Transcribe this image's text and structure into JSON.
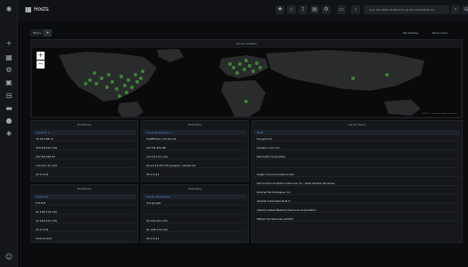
{
  "header": {
    "title": "Hosts"
  },
  "toolbar": {
    "time_range": "⊙ Jul 25, 2019 17:00:13 to Jul 26, 2019 09:00:13"
  },
  "variables": {
    "filters_label": "Filters",
    "add_label": "+"
  },
  "top_links": {
    "view_label": "Pan Display",
    "dashboard_label": "Panel Links"
  },
  "map_panel": {
    "title": "Server Location",
    "zoom_in": "+",
    "zoom_out": "−",
    "attribution": "Leaflet | © OpenStreetMap contributors",
    "point_color": "#37872d"
  },
  "panels": {
    "ip_addresses": {
      "title": "IP Address",
      "column": "Client IP ↓",
      "rows": [
        "76.151.88.11",
        "216.58.210.129",
        "207.96.184.25",
        "172.217.21.144",
        "93.2.0.43"
      ]
    },
    "hostnames": {
      "title": "Hostname",
      "column": "Client Hostname ↓",
      "rows": [
        "mailfiltr4irr-c13.ist.net",
        "157.56.155.88",
        "172.217.21.144",
        "93.ad-19-157-38.dynamic.mtnetr.cdt",
        "93.2.0.43"
      ]
    },
    "server_names": {
      "title": "Server Name",
      "column": "Host",
      "rows": [
        "Google LLC",
        "Amazon.com, Inc.",
        "Microsoft Corporation",
        "",
        "Sagen Communications Sarl",
        "MCI Communications Services, Inc. d/b/a Verizon Business",
        "Akamai Technologies, Inc.",
        "Akamai International B.V.",
        "Liberty Global Network Services Corporation",
        "Telkom SA Services Limited"
      ]
    },
    "server_ip": {
      "title": "IP Address",
      "column": "Server IP",
      "rows": [
        "8.8.8.8",
        "91.198.174.192",
        "52.169.221.135",
        "93.2.0.43",
        "204.0.0.202"
      ]
    },
    "server_hostnames": {
      "title": "Hostname",
      "column": "Server Hostname",
      "rows": [
        "dns.google",
        "",
        "52.169.221.135",
        "91.198.174.144",
        "93.2.0.43"
      ]
    }
  }
}
